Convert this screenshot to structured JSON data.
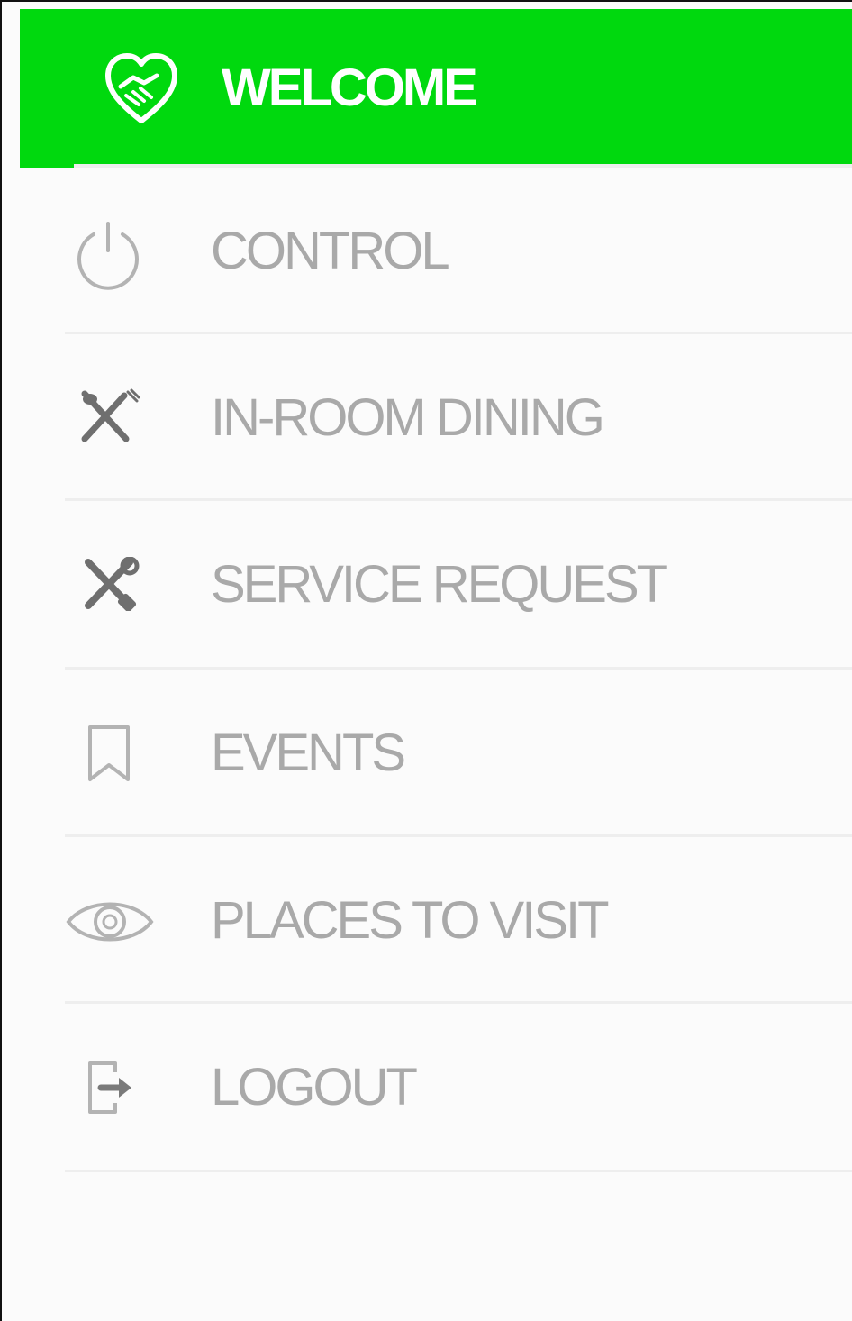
{
  "menu": {
    "active": {
      "label": "WELCOME",
      "icon": "heart-handshake-icon",
      "background": "#00d90e"
    },
    "items": [
      {
        "label": "CONTROL",
        "icon": "power-icon"
      },
      {
        "label": "IN-ROOM DINING",
        "icon": "fork-knife-icon"
      },
      {
        "label": "SERVICE REQUEST",
        "icon": "tools-icon"
      },
      {
        "label": "EVENTS",
        "icon": "bookmark-icon"
      },
      {
        "label": "PLACES TO VISIT",
        "icon": "eye-icon"
      },
      {
        "label": "LOGOUT",
        "icon": "logout-icon"
      }
    ],
    "text_color": "#a9a9a9"
  }
}
